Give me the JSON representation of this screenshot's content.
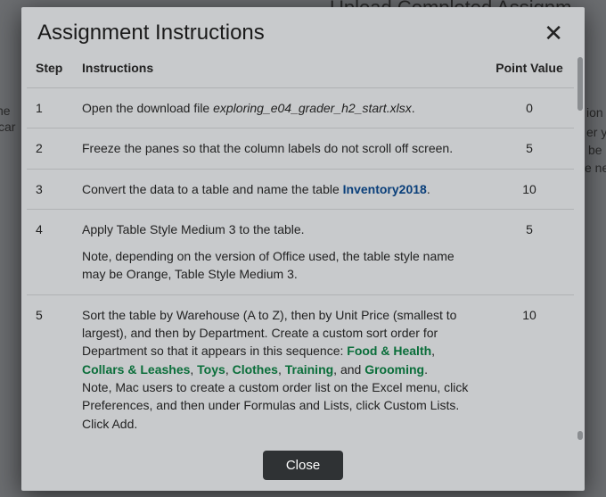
{
  "background": {
    "top_fragment": "Upload Completed Assignm",
    "left_a": "he",
    "left_b": "car",
    "right_a": "ion",
    "right_b": "er y",
    "right_c": "be",
    "right_d": "e ne"
  },
  "modal": {
    "title": "Assignment Instructions",
    "close_icon_text": "✕",
    "close_button": "Close",
    "columns": {
      "step": "Step",
      "instructions": "Instructions",
      "points": "Point Value"
    },
    "rows": [
      {
        "step": "1",
        "points": "0",
        "text_pre": "Open the download file ",
        "filename": "exploring_e04_grader_h2_start.xlsx",
        "text_post": "."
      },
      {
        "step": "2",
        "points": "5",
        "text": "Freeze the panes so that the column labels do not scroll off screen."
      },
      {
        "step": "3",
        "points": "10",
        "text_pre": "Convert the data to a table and name the table ",
        "table_name": "Inventory2018",
        "text_post": "."
      },
      {
        "step": "4",
        "points": "5",
        "text": "Apply Table Style Medium 3 to the table.",
        "note": "Note, depending on the version of Office used, the table style name may be Orange, Table Style Medium 3."
      },
      {
        "step": "5",
        "points": "10",
        "para1_a": "Sort the table by Warehouse (A to Z), then by Unit Price (smallest to largest), and then by Department. Create a custom sort order for Department so that it appears in this sequence: ",
        "cats": [
          "Food & Health",
          "Collars & Leashes",
          "Toys",
          "Clothes",
          "Training",
          "Grooming"
        ],
        "para1_z": ".",
        "sep_comma": ", ",
        "sep_and": ", and ",
        "para2": "Note, Mac users to create a custom order list on the Excel menu, click Preferences, and then under Formulas and Lists, click Custom Lists.",
        "para3": "Click Add."
      }
    ]
  }
}
